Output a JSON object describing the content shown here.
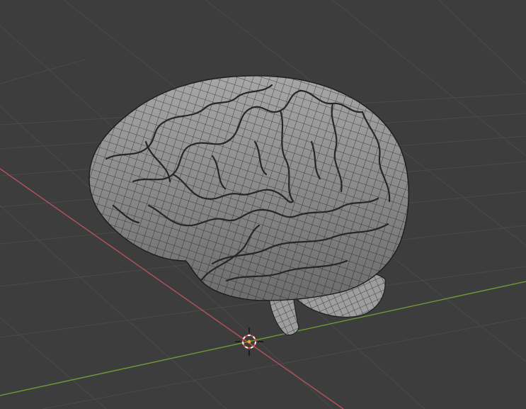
{
  "viewport": {
    "background_color": "#3d3d3d",
    "grid_color": "#4a4a4a",
    "x_axis_color": "#b3525a",
    "y_axis_color": "#6f9a36",
    "mesh": {
      "object": "brain-icon",
      "surface_color": "#a7a7a7",
      "wire_color": "#2d2d2d"
    },
    "cursor": {
      "icon": "3d-cursor-icon",
      "ring_color_a": "#e34b4b",
      "ring_color_b": "#ffffff",
      "center_color": "#f0a030"
    }
  }
}
